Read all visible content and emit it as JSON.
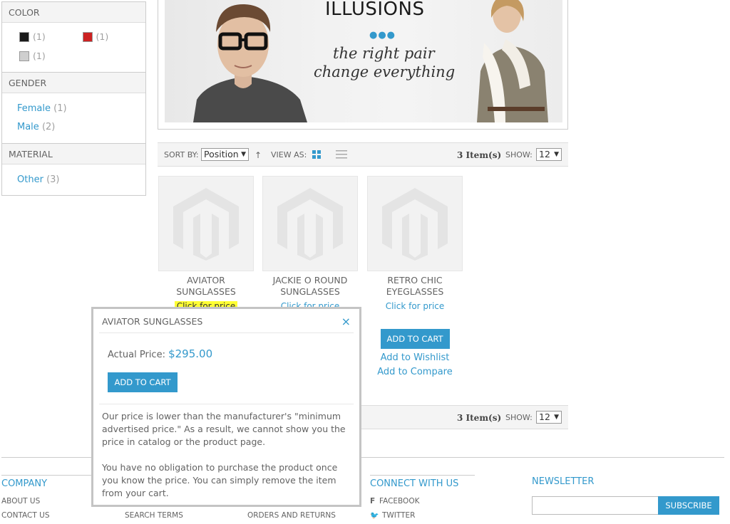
{
  "filters": {
    "color": {
      "title": "COLOR",
      "swatches": [
        {
          "color": "#1a1a1a",
          "count": "(1)"
        },
        {
          "color": "#cc2222",
          "count": "(1)"
        },
        {
          "color": "#cfcfcf",
          "count": "(1)"
        }
      ]
    },
    "gender": {
      "title": "GENDER",
      "items": [
        {
          "label": "Female",
          "count": "(1)"
        },
        {
          "label": "Male",
          "count": "(2)"
        }
      ]
    },
    "material": {
      "title": "MATERIAL",
      "items": [
        {
          "label": "Other",
          "count": "(3)"
        }
      ]
    }
  },
  "hero": {
    "title": "ILLUSIONS",
    "dots": "●●●",
    "line1": "the right pair",
    "line2": "change everything"
  },
  "toolbar": {
    "sort_label": "SORT BY:",
    "sort_value": "Position",
    "view_label": "VIEW AS:",
    "items_count": "3 Item(s)",
    "show_label": "SHOW:",
    "show_value": "12"
  },
  "products": [
    {
      "name": "AVIATOR SUNGLASSES",
      "price": "Click for price",
      "rating": "★★★★"
    },
    {
      "name": "JACKIE O ROUND SUNGLASSES",
      "price": "Click for price"
    },
    {
      "name": "RETRO CHIC EYEGLASSES",
      "price": "Click for price",
      "add_to_cart": "ADD TO CART",
      "wishlist": "Add to Wishlist",
      "compare": "Add to Compare"
    }
  ],
  "popup": {
    "title": "AVIATOR SUNGLASSES",
    "close": "×",
    "price_label": "Actual Price:",
    "price_value": "$295.00",
    "add_to_cart": "ADD TO CART",
    "text1": "Our price is lower than the manufacturer's \"minimum advertised price.\" As a result, we cannot show you the price in catalog or the product page.",
    "text2": "You have no obligation to purchase the product once you know the price. You can simply remove the item from your cart."
  },
  "footer": {
    "company_title": "COMPANY",
    "about": "ABOUT US",
    "contact": "CONTACT US",
    "search_terms": "SEARCH TERMS",
    "orders_returns": "ORDERS AND RETURNS",
    "connect_title": "CONNECT WITH US",
    "facebook": "FACEBOOK",
    "twitter": "TWITTER",
    "newsletter_title": "NEWSLETTER",
    "subscribe": "SUBSCRIBE"
  },
  "colors": {
    "accent": "#3399cc",
    "highlight": "#ffff33"
  }
}
